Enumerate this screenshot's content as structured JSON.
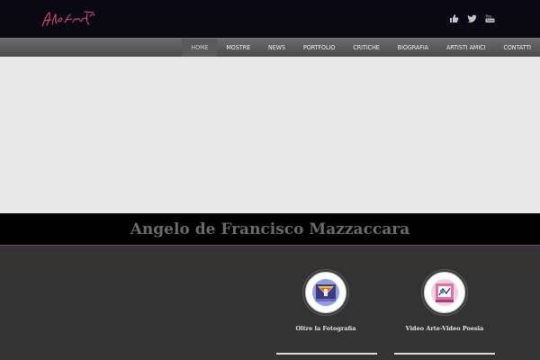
{
  "header": {
    "logo": {
      "alt": "signature-logo",
      "color": "#e0507a"
    },
    "social": [
      {
        "icon": "thumbs-up-icon",
        "name": "facebook"
      },
      {
        "icon": "twitter-bird-icon",
        "name": "twitter"
      },
      {
        "icon": "youtube-icon",
        "name": "youtube"
      }
    ]
  },
  "nav": {
    "items": [
      {
        "label": "HOME",
        "active": true
      },
      {
        "label": "MOSTRE",
        "active": false
      },
      {
        "label": "NEWS",
        "active": false
      },
      {
        "label": "PORTFOLIO",
        "active": false
      },
      {
        "label": "CRITICHE",
        "active": false
      },
      {
        "label": "BIOGRAFIA",
        "active": false
      },
      {
        "label": "ARTISTI AMICI",
        "active": false
      },
      {
        "label": "CONTATTI",
        "active": false
      }
    ]
  },
  "site": {
    "title": "Angelo de Francisco Mazzaccara"
  },
  "features": [
    {
      "label": "Oltre la Fotografia",
      "icon": "artwork-thumbnail-icon"
    },
    {
      "label": "Video Arte-Video Poesia",
      "icon": "video-art-thumbnail-icon"
    }
  ],
  "colors": {
    "topbar": "#0a0913",
    "nav": "#5a5a5a",
    "slider": "#e8e8e8",
    "band": "#000000",
    "body": "#333333"
  }
}
